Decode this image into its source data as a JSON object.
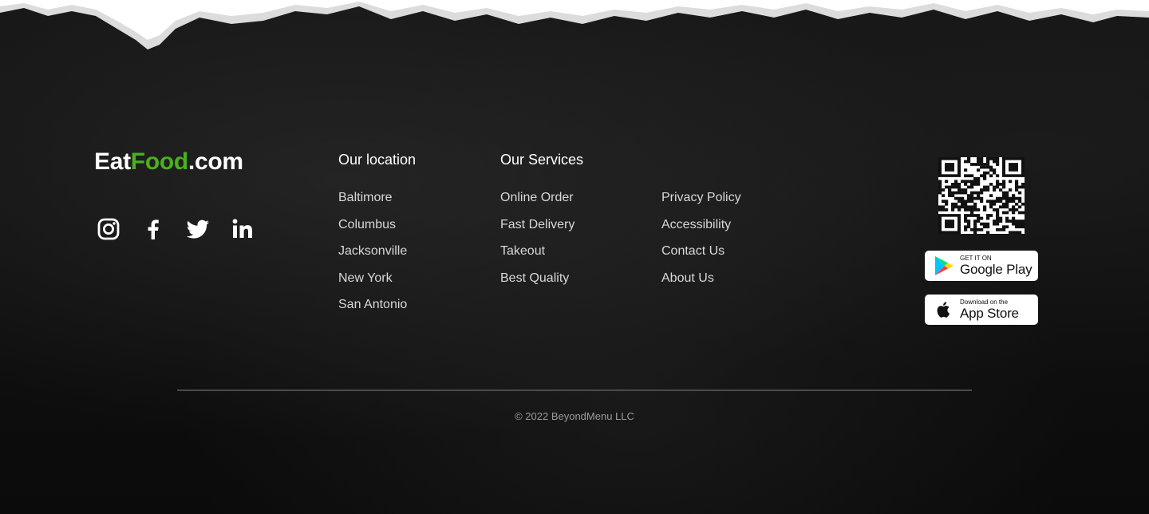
{
  "brand": {
    "part1": "Eat",
    "part2": "Food",
    "part3": ".com",
    "accent_color": "#4caf1f"
  },
  "social": [
    {
      "name": "instagram-icon"
    },
    {
      "name": "facebook-icon"
    },
    {
      "name": "twitter-icon"
    },
    {
      "name": "linkedin-icon"
    }
  ],
  "locations": {
    "title": "Our location",
    "items": [
      "Baltimore",
      "Columbus",
      "Jacksonville",
      "New York",
      "San Antonio"
    ]
  },
  "services": {
    "title": "Our Services",
    "items": [
      "Online Order",
      "Fast Delivery",
      "Takeout",
      "Best Quality"
    ]
  },
  "info_links": {
    "items": [
      "Privacy Policy",
      "Accessibility",
      "Contact Us",
      "About Us"
    ]
  },
  "apps": {
    "google_play": {
      "small": "GET IT ON",
      "big": "Google Play",
      "icon": "google-play-icon"
    },
    "app_store": {
      "small": "Download on the",
      "big": "App Store",
      "icon": "apple-icon"
    }
  },
  "copyright": "© 2022 BeyondMenu LLC",
  "colors": {
    "background": "#0d0d0d",
    "text": "#ffffff",
    "muted": "#9a9a9a"
  }
}
